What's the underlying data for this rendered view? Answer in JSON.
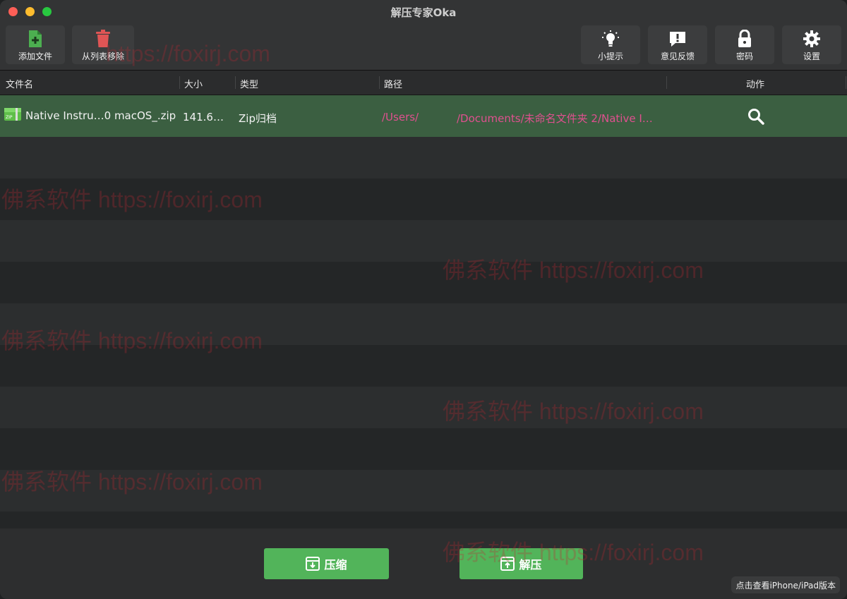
{
  "window": {
    "title": "解压专家Oka"
  },
  "toolbar": {
    "left": [
      {
        "label": "添加文件",
        "icon": "add-file-icon",
        "color": "#4caf50"
      },
      {
        "label": "从列表移除",
        "icon": "trash-icon",
        "color": "#e05555"
      }
    ],
    "right": [
      {
        "label": "小提示",
        "icon": "lightbulb-icon"
      },
      {
        "label": "意见反馈",
        "icon": "feedback-icon"
      },
      {
        "label": "密码",
        "icon": "lock-icon"
      },
      {
        "label": "设置",
        "icon": "gear-icon"
      }
    ]
  },
  "table": {
    "columns": [
      "文件名",
      "大小",
      "类型",
      "路径",
      "动作"
    ],
    "rows": [
      {
        "name": "Native Instru…0 macOS_.zip",
        "size": "141.6…",
        "type": "Zip归档",
        "path_prefix": "/Users/",
        "path_suffix": "/Documents/未命名文件夹 2/Native I…",
        "file_icon_label": "ZIP",
        "action_icon": "search-icon"
      }
    ]
  },
  "bottom": {
    "compress_label": "压缩",
    "extract_label": "解压",
    "ipad_link": "点击查看iPhone/iPad版本"
  },
  "watermark": {
    "text": "佛系软件 https://foxirj.com",
    "partial_text": "https://foxirj.com"
  },
  "colors": {
    "selected_row": "#3b5f41",
    "path_text": "#e0508f",
    "action_button": "#52b45a"
  }
}
